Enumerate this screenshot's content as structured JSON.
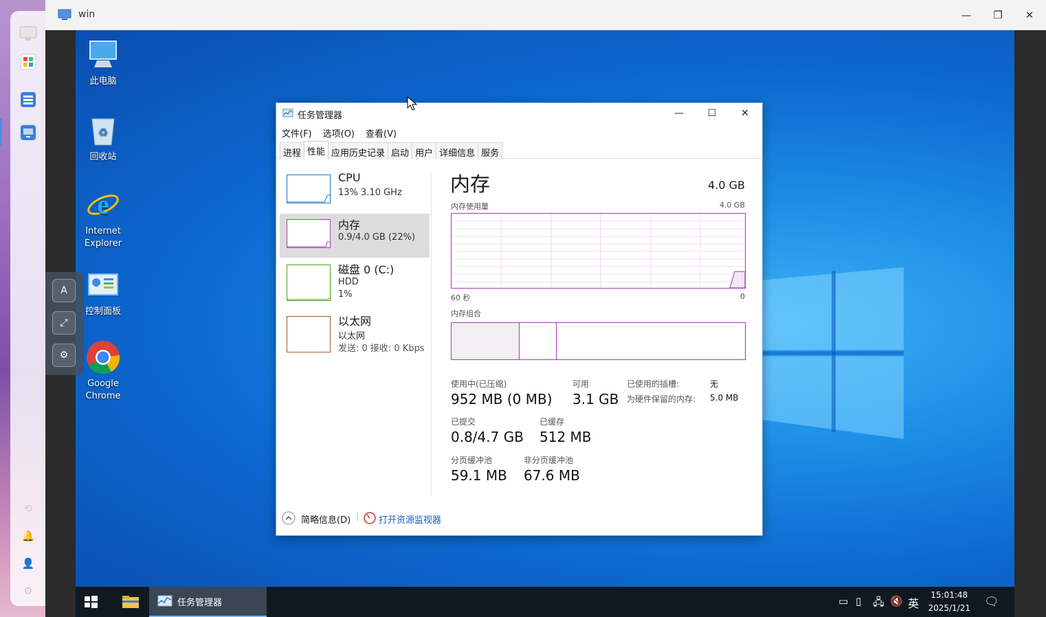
{
  "host": {
    "window_title": "win",
    "sidebar_icons": [
      "monitor-icon",
      "apps-grid-icon",
      "server-list-icon",
      "remote-desktop-icon"
    ],
    "sidebar_bottom_icons": [
      "refresh-icon",
      "bell-icon",
      "user-icon",
      "gear-icon"
    ],
    "float_tools": [
      "keyboard-icon",
      "fullscreen-icon",
      "settings-icon"
    ],
    "accent": "#4a90e2"
  },
  "desktop": {
    "icons": [
      {
        "label": "此电脑"
      },
      {
        "label": "回收站"
      },
      {
        "label": "Internet Explorer"
      },
      {
        "label": "控制面板"
      },
      {
        "label": "Google Chrome"
      }
    ]
  },
  "taskmgr": {
    "title": "任务管理器",
    "menu": [
      "文件(F)",
      "选项(O)",
      "查看(V)"
    ],
    "tabs": [
      "进程",
      "性能",
      "应用历史记录",
      "启动",
      "用户",
      "详细信息",
      "服务"
    ],
    "active_tab": "性能",
    "side": [
      {
        "name": "CPU",
        "sub1": "13% 3.10 GHz",
        "color": "#1a77c9"
      },
      {
        "name": "内存",
        "sub1": "0.9/4.0 GB (22%)",
        "color": "#a639b8"
      },
      {
        "name": "磁盘 0 (C:)",
        "sub1": "HDD",
        "sub2": "1%",
        "color": "#4da60c"
      },
      {
        "name": "以太网",
        "sub1": "以太网",
        "sub2": "发送: 0 接收: 0 Kbps",
        "color": "#a7592f"
      }
    ],
    "main": {
      "title": "内存",
      "total": "4.0 GB",
      "usage_label": "内存使用量",
      "usage_max": "4.0 GB",
      "time_left": "60 秒",
      "time_right": "0",
      "composition_label": "内存组合",
      "in_use_fraction": 0.22,
      "stats": {
        "in_use_lbl": "使用中(已压缩)",
        "in_use_val": "952 MB (0 MB)",
        "avail_lbl": "可用",
        "avail_val": "3.1 GB",
        "commit_lbl": "已提交",
        "commit_val": "0.8/4.7 GB",
        "cached_lbl": "已缓存",
        "cached_val": "512 MB",
        "paged_lbl": "分页缓冲池",
        "paged_val": "59.1 MB",
        "nonpaged_lbl": "非分页缓冲池",
        "nonpaged_val": "67.6 MB",
        "slots_lbl": "已使用的插槽:",
        "slots_val": "无",
        "reserved_lbl": "为硬件保留的内存:",
        "reserved_val": "5.0 MB"
      }
    },
    "footer": {
      "less_details": "简略信息(D)",
      "open_monitor": "打开资源监视器"
    }
  },
  "taskbar": {
    "app_label": "任务管理器",
    "ime": "英",
    "time": "15:01:48",
    "date": "2025/1/21"
  }
}
